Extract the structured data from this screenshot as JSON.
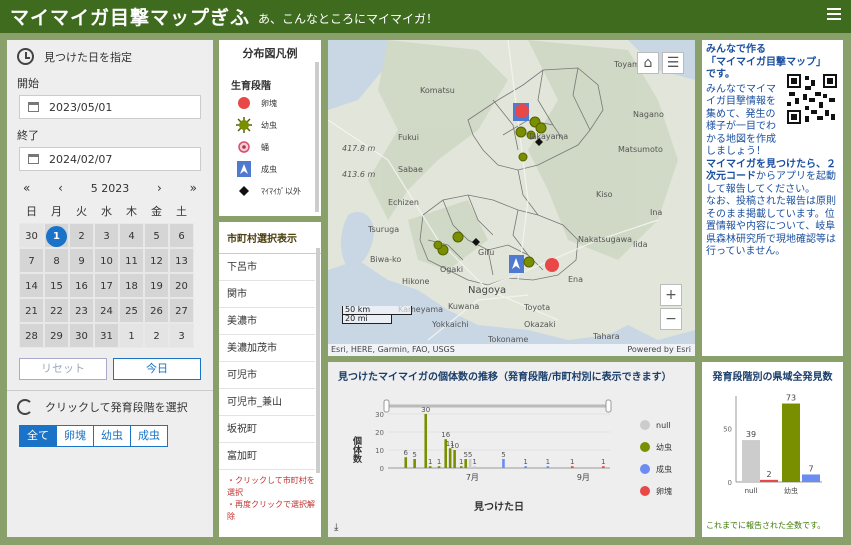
{
  "header": {
    "title": "マイマイガ目撃マップぎふ",
    "subtitle": "あ、こんなところにマイマイガ！",
    "menu_icon": "hamburger-icon"
  },
  "date_filter": {
    "heading": "見つけた日を指定",
    "start_label": "開始",
    "start_value": "2023/05/01",
    "end_label": "終了",
    "end_value": "2024/02/07",
    "nav": {
      "prev_year": "«",
      "prev_month": "‹",
      "month_label": "5 2023",
      "next_month": "›",
      "next_year": "»"
    },
    "weekdays": [
      "日",
      "月",
      "火",
      "水",
      "木",
      "金",
      "土"
    ],
    "days": [
      "30",
      "1",
      "2",
      "3",
      "4",
      "5",
      "6",
      "7",
      "8",
      "9",
      "10",
      "11",
      "12",
      "13",
      "14",
      "15",
      "16",
      "17",
      "18",
      "19",
      "20",
      "21",
      "22",
      "23",
      "24",
      "25",
      "26",
      "27",
      "28",
      "29",
      "30",
      "31",
      "1",
      "2",
      "3"
    ],
    "selected_day": "1",
    "reset_label": "リセット",
    "today_label": "今日"
  },
  "stage_filter": {
    "heading": "クリックして発育段階を選択",
    "buttons": [
      "全て",
      "卵塊",
      "幼虫",
      "成虫"
    ],
    "active": "全て"
  },
  "legend": {
    "title": "分布図凡例",
    "subtitle": "生育段階",
    "items": [
      {
        "label": "卵塊",
        "symbol": "red-circle"
      },
      {
        "label": "幼虫",
        "symbol": "olive-spiky-circle"
      },
      {
        "label": "蛹",
        "symbol": "pink-ring"
      },
      {
        "label": "成虫",
        "symbol": "blue-arrow-marker"
      },
      {
        "label": "ﾏｲﾏｲｶﾞ以外",
        "symbol": "black-diamond"
      }
    ]
  },
  "municipality": {
    "title": "市町村選択表示",
    "items": [
      "下呂市",
      "関市",
      "美濃市",
      "美濃加茂市",
      "可児市",
      "可児市_兼山",
      "坂祝町",
      "富加町"
    ],
    "note1": "・クリックして市町村を選択",
    "note2": "・再度クリックで選択解除"
  },
  "map": {
    "labels": [
      "Komatsu",
      "Fukui",
      "Takayama",
      "Biwa-ko",
      "Hikone",
      "Gifu",
      "Nagoya",
      "Toyota",
      "Okazaki",
      "Yokkaichi",
      "Sabae",
      "Echizen",
      "Tsuruga",
      "Toyama",
      "Nagano",
      "Iida",
      "Nakatsugawa",
      "Ena",
      "Ogaki",
      "Kuwana",
      "Kameyama",
      "Tokoname",
      "Tahara",
      "Matsumoto",
      "Kiso",
      "Ina"
    ],
    "elevation_labels": [
      "417.8 m",
      "413.6 m"
    ],
    "scale_km": "50 km",
    "scale_mi": "20 mi",
    "attribution": "Esri, HERE, Garmin, FAO, USGS",
    "powered": "Powered by Esri",
    "zoom_in": "+",
    "zoom_out": "−"
  },
  "info": {
    "title1": "みんなで作る",
    "title2": "「マイマイガ目撃マップ」",
    "title3": "です。",
    "body1": "みんなでマイマイガ目撃情報を集めて、発生の様子が一目でわかる地図を作成しましょう！",
    "highlight1": "マイマイガを見つけたら、",
    "highlight2": "２次元コード",
    "body2": "からアプリを起動して報告してください。",
    "body3": "なお、投稿された報告は原則そのまま掲載しています。位置情報や内容について、岐阜県森林研究所で現地確認等は行っていません。"
  },
  "trend": {
    "title": "見つけたマイマイガの個体数の推移（発育段階/市町村別に表示できます）",
    "ylabel": "個体数",
    "xlabel": "見つけた日",
    "yticks": [
      "30",
      "20",
      "10",
      "0"
    ],
    "xticks": [
      "7月",
      "9月"
    ],
    "legend": [
      {
        "name": "null",
        "color": "#cccccc"
      },
      {
        "name": "幼虫",
        "color": "#7a8f00"
      },
      {
        "name": "成虫",
        "color": "#6b8cf0"
      },
      {
        "name": "卵塊",
        "color": "#e84848"
      }
    ],
    "download_icon": "download-icon"
  },
  "chart_data": [
    {
      "type": "bar",
      "title": "見つけたマイマイガの個体数の推移（発育段階/市町村別に表示できます）",
      "xlabel": "見つけた日",
      "ylabel": "個体数",
      "ylim": [
        0,
        30
      ],
      "series": [
        {
          "name": "幼虫",
          "color": "#7a8f00",
          "points": [
            [
              0.08,
              6
            ],
            [
              0.12,
              5
            ],
            [
              0.17,
              30
            ],
            [
              0.19,
              1
            ],
            [
              0.23,
              1
            ],
            [
              0.26,
              16
            ],
            [
              0.28,
              11
            ],
            [
              0.3,
              10
            ],
            [
              0.33,
              1
            ],
            [
              0.35,
              5
            ]
          ]
        },
        {
          "name": "null",
          "color": "#cccccc",
          "points": [
            [
              0.37,
              5
            ],
            [
              0.39,
              1
            ]
          ]
        },
        {
          "name": "成虫",
          "color": "#6b8cf0",
          "points": [
            [
              0.52,
              5
            ],
            [
              0.62,
              1
            ],
            [
              0.72,
              1
            ]
          ]
        },
        {
          "name": "卵塊",
          "color": "#e84848",
          "points": [
            [
              0.83,
              1
            ],
            [
              0.97,
              1
            ]
          ]
        }
      ],
      "value_labels": [
        "30",
        "6",
        "5",
        "16",
        "11",
        "5",
        "5",
        "1",
        "1",
        "1",
        "1",
        "1",
        "1"
      ]
    },
    {
      "type": "bar",
      "title": "発育段階別の県域全発見数",
      "categories": [
        "null",
        "幼虫"
      ],
      "ylim": [
        0,
        80
      ],
      "yticks": [
        "50",
        "0"
      ],
      "series": [
        {
          "name": "null",
          "color": "#cccccc",
          "values": [
            39
          ]
        },
        {
          "name": "卵塊",
          "color": "#e84848",
          "values": [
            2
          ]
        },
        {
          "name": "幼虫",
          "color": "#7a8f00",
          "values": [
            73
          ]
        },
        {
          "name": "成虫",
          "color": "#6b8cf0",
          "values": [
            7
          ]
        }
      ],
      "footnote": "これまでに報告された全数です。"
    }
  ]
}
